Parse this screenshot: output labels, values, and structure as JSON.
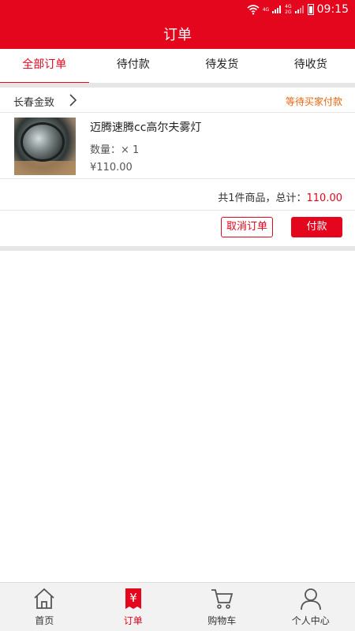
{
  "status_bar": {
    "network_top": "4G",
    "network_stack": [
      "4G",
      "2G"
    ],
    "time": "09:15"
  },
  "header": {
    "title": "订单"
  },
  "tabs": [
    {
      "label": "全部订单",
      "active": true
    },
    {
      "label": "待付款",
      "active": false
    },
    {
      "label": "待发货",
      "active": false
    },
    {
      "label": "待收货",
      "active": false
    }
  ],
  "order": {
    "shop_name": "长春金致",
    "status": "等待买家付款",
    "item": {
      "name": "迈腾速腾cc高尔夫雾灯",
      "quantity": "数量：× 1",
      "price": "¥110.00"
    },
    "summary_prefix": "共1件商品，总计：",
    "total": "110.00",
    "cancel_label": "取消订单",
    "pay_label": "付款"
  },
  "bottom_nav": [
    {
      "label": "首页",
      "icon": "home-icon",
      "active": false
    },
    {
      "label": "订单",
      "icon": "order-yen-icon",
      "active": true
    },
    {
      "label": "购物车",
      "icon": "cart-icon",
      "active": false
    },
    {
      "label": "个人中心",
      "icon": "person-icon",
      "active": false
    }
  ],
  "colors": {
    "brand": "#e4061d",
    "status_orange": "#e8660e"
  }
}
